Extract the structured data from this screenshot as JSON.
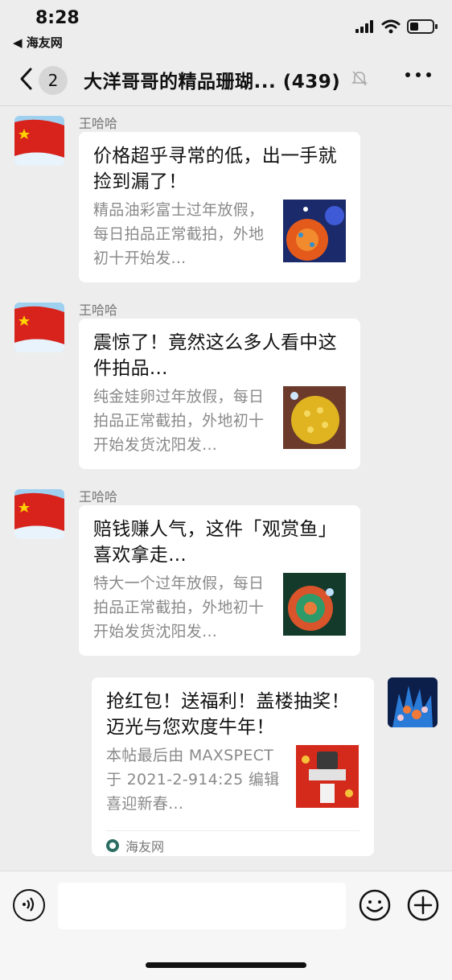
{
  "status_bar": {
    "time": "8:28",
    "back_app": "◀ 海友网"
  },
  "nav": {
    "unread_count": "2",
    "title": "大洋哥哥的精品珊瑚... (439)"
  },
  "messages": [
    {
      "sender": "王哈哈",
      "title": "价格超乎寻常的低，出一手就捡到漏了！",
      "desc": "精品油彩富士过年放假，每日拍品正常截拍，外地初十开始发..."
    },
    {
      "sender": "王哈哈",
      "title": "震惊了！竟然这么多人看中这件拍品...",
      "desc": "纯金娃卵过年放假，每日拍品正常截拍，外地初十开始发货沈阳发..."
    },
    {
      "sender": "王哈哈",
      "title": "赔钱赚人气，这件「观赏鱼」喜欢拿走...",
      "desc": "特大一个过年放假，每日拍品正常截拍，外地初十开始发货沈阳发..."
    },
    {
      "sender": "",
      "title": "抢红包！送福利！盖楼抽奖！迈光与您欢度牛年！",
      "desc": "本帖最后由 MAXSPECT 于 2021-2-914:25 编辑喜迎新春...",
      "source": "海友网"
    }
  ],
  "colors": {
    "background": "#ededed",
    "card": "#ffffff",
    "muted_text": "#8a8a8a"
  }
}
